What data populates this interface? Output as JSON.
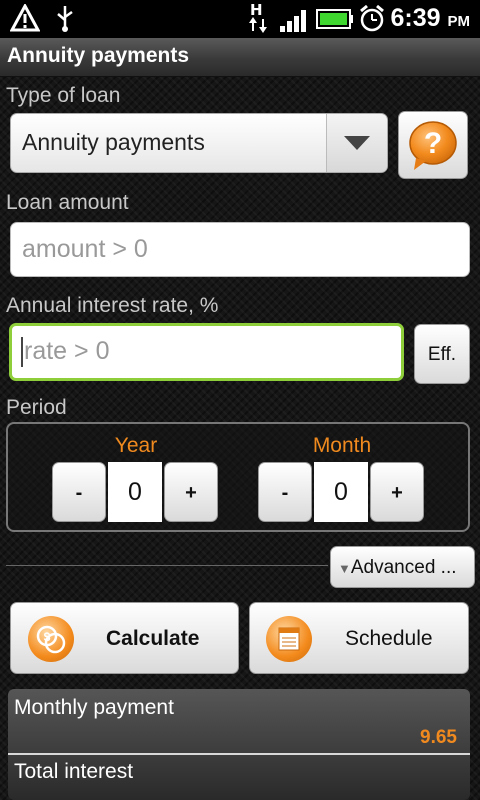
{
  "status_bar": {
    "time": "6:39",
    "ampm": "PM",
    "network": "H",
    "icons": [
      "warning-icon",
      "usb-icon",
      "signal-icon",
      "battery-icon",
      "alarm-icon"
    ]
  },
  "title_bar": {
    "title": "Annuity payments"
  },
  "loan_type": {
    "label": "Type of loan",
    "selected": "Annuity payments",
    "help_icon": "question-mark-icon"
  },
  "loan_amount": {
    "label": "Loan amount",
    "value": "",
    "placeholder": "amount > 0"
  },
  "interest_rate": {
    "label": "Annual interest rate, %",
    "value": "",
    "placeholder": "rate > 0",
    "eff_label": "Eff."
  },
  "period": {
    "label": "Period",
    "year": {
      "label": "Year",
      "value": "0",
      "minus": "-",
      "plus": "+"
    },
    "month": {
      "label": "Month",
      "value": "0",
      "minus": "-",
      "plus": "+"
    }
  },
  "advanced": {
    "label": "Advanced ...",
    "arrow": "▼"
  },
  "actions": {
    "calculate": "Calculate",
    "schedule": "Schedule"
  },
  "results": {
    "monthly_payment_label": "Monthly payment",
    "monthly_payment_value": "9.65",
    "total_interest_label": "Total interest"
  },
  "colors": {
    "accent": "#f08a1f",
    "focus": "#8fce3b"
  }
}
